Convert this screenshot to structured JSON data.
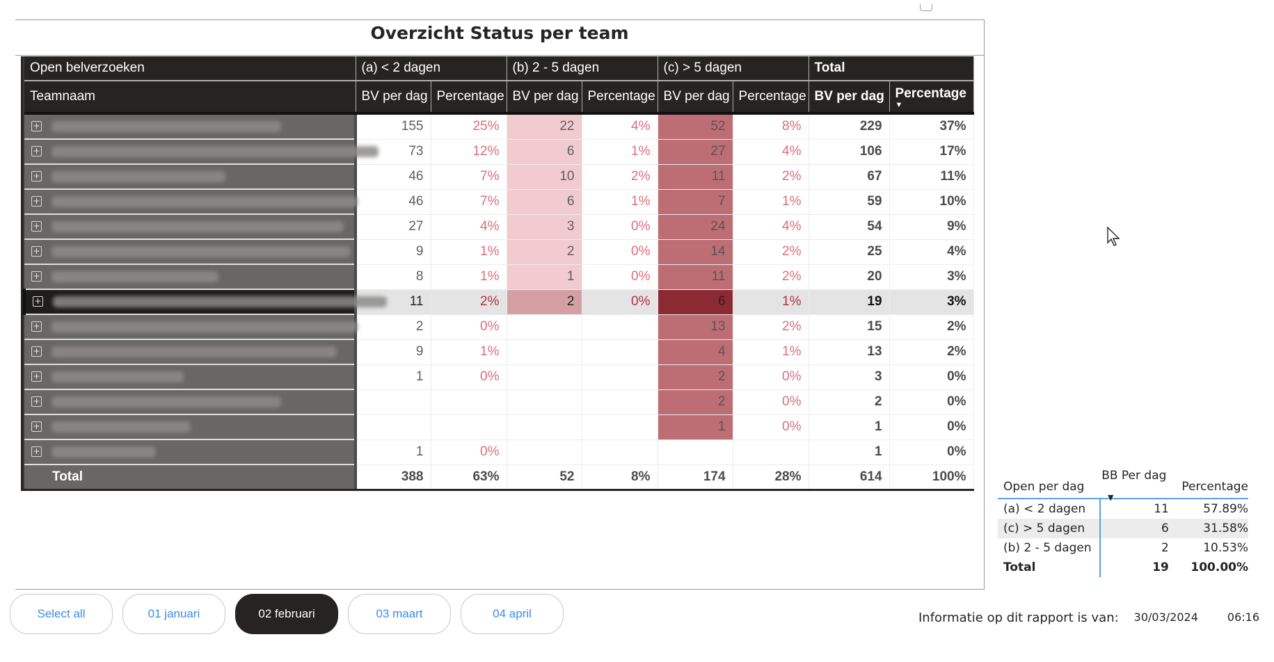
{
  "report": {
    "title": "Overzicht Status per team"
  },
  "matrix": {
    "row_header_top": "Open belverzoeken",
    "row_header": "Teamnaam",
    "groups": [
      "(a) < 2 dagen",
      "(b) 2 - 5 dagen",
      "(c) > 5 dagen",
      "Total"
    ],
    "subheaders": [
      "BV per dag",
      "Percentage",
      "BV per dag",
      "Percentage",
      "BV per dag",
      "Percentage",
      "BV per dag",
      "Percentage"
    ],
    "sorted_column": "Total Percentage (descending)",
    "team_names_visible": false,
    "rows": [
      {
        "a_bv": "155",
        "a_pct": "25%",
        "b_bv": "22",
        "b_pct": "4%",
        "c_bv": "52",
        "c_pct": "8%",
        "t_bv": "229",
        "t_pct": "37%"
      },
      {
        "a_bv": "73",
        "a_pct": "12%",
        "b_bv": "6",
        "b_pct": "1%",
        "c_bv": "27",
        "c_pct": "4%",
        "t_bv": "106",
        "t_pct": "17%"
      },
      {
        "a_bv": "46",
        "a_pct": "7%",
        "b_bv": "10",
        "b_pct": "2%",
        "c_bv": "11",
        "c_pct": "2%",
        "t_bv": "67",
        "t_pct": "11%"
      },
      {
        "a_bv": "46",
        "a_pct": "7%",
        "b_bv": "6",
        "b_pct": "1%",
        "c_bv": "7",
        "c_pct": "1%",
        "t_bv": "59",
        "t_pct": "10%"
      },
      {
        "a_bv": "27",
        "a_pct": "4%",
        "b_bv": "3",
        "b_pct": "0%",
        "c_bv": "24",
        "c_pct": "4%",
        "t_bv": "54",
        "t_pct": "9%"
      },
      {
        "a_bv": "9",
        "a_pct": "1%",
        "b_bv": "2",
        "b_pct": "0%",
        "c_bv": "14",
        "c_pct": "2%",
        "t_bv": "25",
        "t_pct": "4%"
      },
      {
        "a_bv": "8",
        "a_pct": "1%",
        "b_bv": "1",
        "b_pct": "0%",
        "c_bv": "11",
        "c_pct": "2%",
        "t_bv": "20",
        "t_pct": "3%"
      },
      {
        "a_bv": "11",
        "a_pct": "2%",
        "b_bv": "2",
        "b_pct": "0%",
        "c_bv": "6",
        "c_pct": "1%",
        "t_bv": "19",
        "t_pct": "3%",
        "selected": true
      },
      {
        "a_bv": "2",
        "a_pct": "0%",
        "b_bv": "",
        "b_pct": "",
        "c_bv": "13",
        "c_pct": "2%",
        "t_bv": "15",
        "t_pct": "2%"
      },
      {
        "a_bv": "9",
        "a_pct": "1%",
        "b_bv": "",
        "b_pct": "",
        "c_bv": "4",
        "c_pct": "1%",
        "t_bv": "13",
        "t_pct": "2%"
      },
      {
        "a_bv": "1",
        "a_pct": "0%",
        "b_bv": "",
        "b_pct": "",
        "c_bv": "2",
        "c_pct": "0%",
        "t_bv": "3",
        "t_pct": "0%"
      },
      {
        "a_bv": "",
        "a_pct": "",
        "b_bv": "",
        "b_pct": "",
        "c_bv": "2",
        "c_pct": "0%",
        "t_bv": "2",
        "t_pct": "0%"
      },
      {
        "a_bv": "",
        "a_pct": "",
        "b_bv": "",
        "b_pct": "",
        "c_bv": "1",
        "c_pct": "0%",
        "t_bv": "1",
        "t_pct": "0%"
      },
      {
        "a_bv": "1",
        "a_pct": "0%",
        "b_bv": "",
        "b_pct": "",
        "c_bv": "",
        "c_pct": "",
        "t_bv": "1",
        "t_pct": "0%"
      }
    ],
    "total": {
      "label": "Total",
      "a_bv": "388",
      "a_pct": "63%",
      "b_bv": "52",
      "b_pct": "8%",
      "c_bv": "174",
      "c_pct": "28%",
      "t_bv": "614",
      "t_pct": "100%"
    },
    "colors": {
      "header_bg": "#252423",
      "b_highlight": "#f2cbd0",
      "c_highlight": "#bd6e74",
      "selected_c": "#8b2a33",
      "percent_text": "#e06c7b"
    }
  },
  "summary": {
    "headers": [
      "Open per dag",
      "BB Per dag",
      "Percentage"
    ],
    "rows": [
      {
        "label": "(a) < 2 dagen",
        "value": "11",
        "pct": "57.89%"
      },
      {
        "label": "(c) > 5 dagen",
        "value": "6",
        "pct": "31.58%"
      },
      {
        "label": "(b) 2 - 5 dagen",
        "value": "2",
        "pct": "10.53%"
      }
    ],
    "total": {
      "label": "Total",
      "value": "19",
      "pct": "100.00%"
    }
  },
  "slicer": {
    "options": [
      "Select all",
      "01 januari",
      "02 februari",
      "03 maart",
      "04 april"
    ],
    "selected": "02 februari"
  },
  "footer": {
    "label": "Informatie op dit rapport is van:",
    "date": "30/03/2024",
    "time": "06:16"
  }
}
